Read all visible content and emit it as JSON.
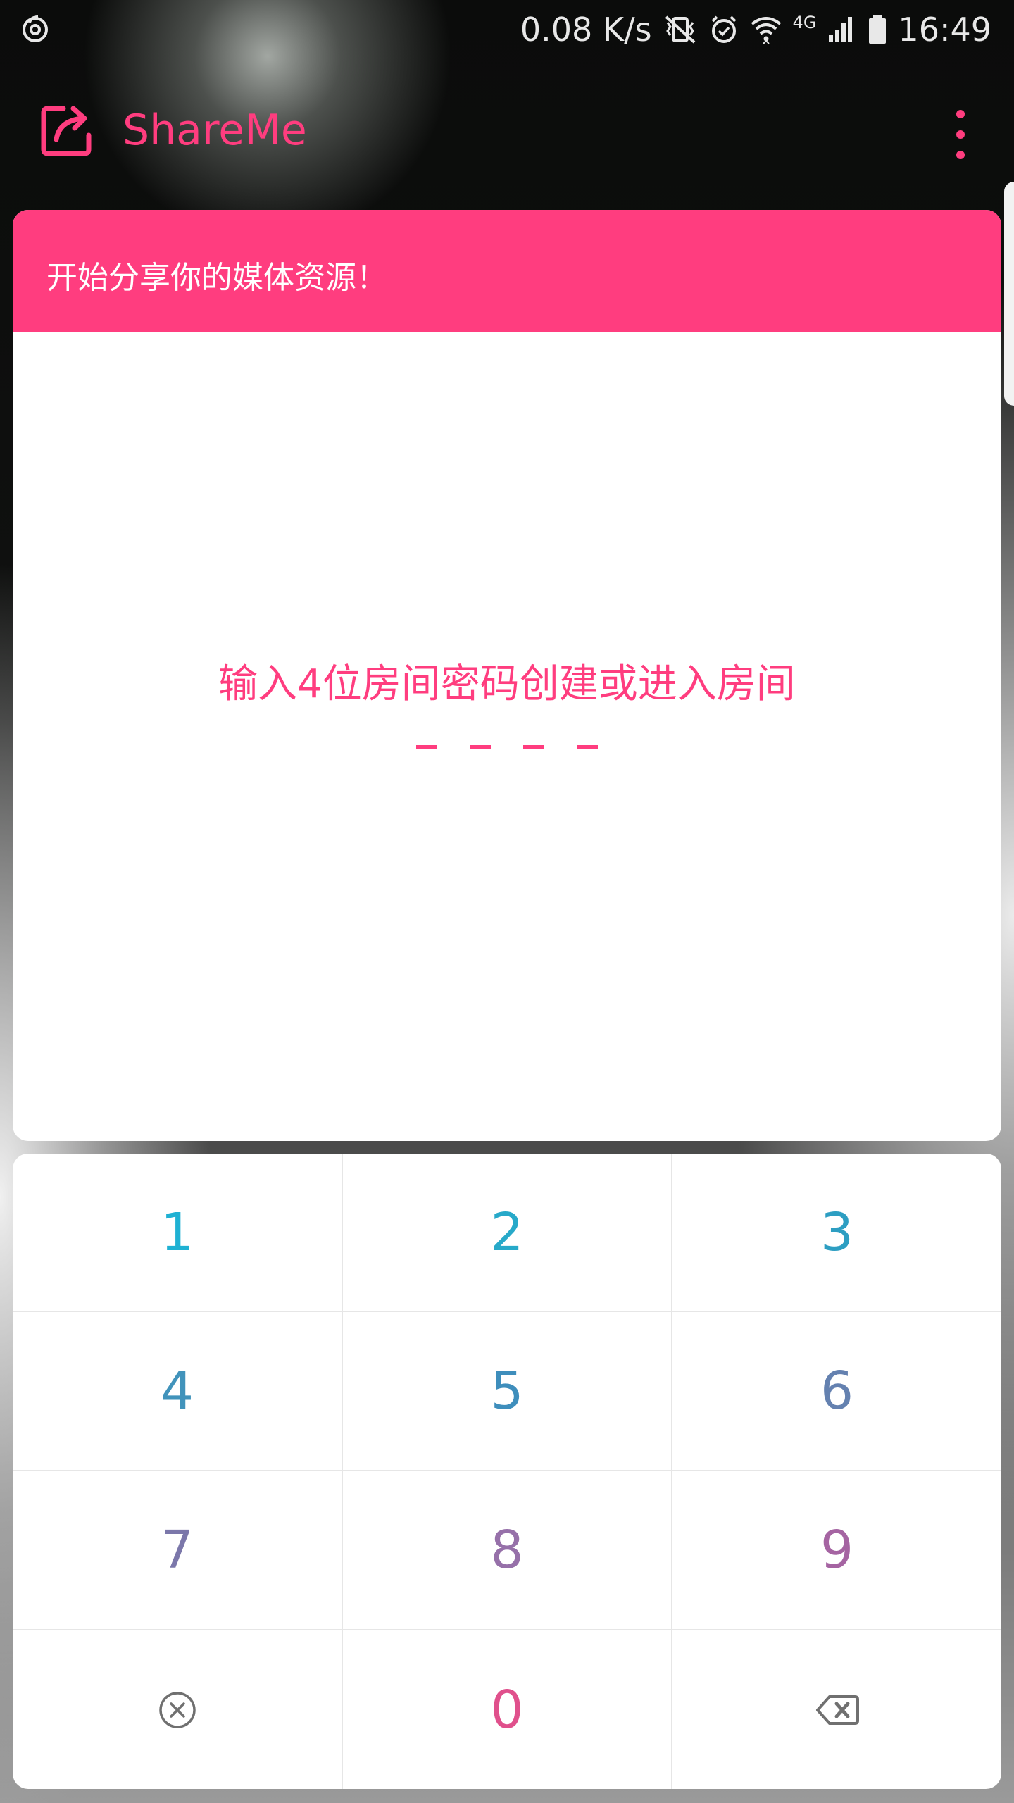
{
  "status_bar": {
    "network_speed": "0.08 K/s",
    "network_type": "4G",
    "time": "16:49",
    "icons": [
      "netease-music-icon",
      "vibrate-icon",
      "alarm-icon",
      "wifi-icon",
      "signal-icon",
      "battery-icon"
    ]
  },
  "app_bar": {
    "title": "ShareMe",
    "logo_icon": "share-icon",
    "menu_icon": "more-vert-icon",
    "accent_color": "#ff3d7f"
  },
  "card": {
    "header_text": "开始分享你的媒体资源！",
    "prompt": "输入4位房间密码创建或进入房间",
    "code_length": 4,
    "header_color": "#ff3d7f"
  },
  "keypad": {
    "keys": [
      {
        "label": "1",
        "color": "#1fb1d3"
      },
      {
        "label": "2",
        "color": "#27a9c9"
      },
      {
        "label": "3",
        "color": "#2d9ec2"
      },
      {
        "label": "4",
        "color": "#4193bb"
      },
      {
        "label": "5",
        "color": "#3e8ebc"
      },
      {
        "label": "6",
        "color": "#6481b0"
      },
      {
        "label": "7",
        "color": "#7b77aa"
      },
      {
        "label": "8",
        "color": "#9670a9"
      },
      {
        "label": "9",
        "color": "#a564a2"
      },
      {
        "label": "",
        "icon": "clear-icon"
      },
      {
        "label": "0",
        "color": "#e0508c"
      },
      {
        "label": "",
        "icon": "backspace-icon"
      }
    ]
  }
}
